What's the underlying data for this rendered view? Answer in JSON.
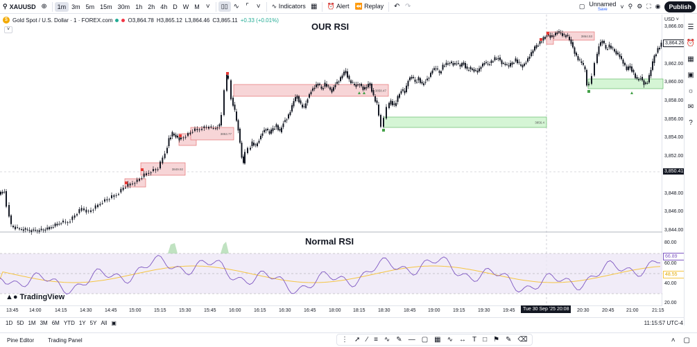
{
  "toolbar": {
    "symbol": "XAUUSD",
    "intervals": [
      "1m",
      "3m",
      "5m",
      "15m",
      "30m",
      "1h",
      "2h",
      "4h",
      "D",
      "W",
      "M"
    ],
    "active_interval": "1m",
    "indicators_label": "Indicators",
    "alert_label": "Alert",
    "replay_label": "Replay",
    "layout_name": "Unnamed",
    "layout_save": "Save",
    "publish_label": "Publish"
  },
  "legend": {
    "title": "Gold Spot / U.S. Dollar · 1 · FOREX.com",
    "open": "O3,864.78",
    "high": "H3,865.12",
    "low": "L3,864.46",
    "close": "C3,865.11",
    "change": "+0.33 (+0.01%)"
  },
  "panes": {
    "main_title": "OUR RSI",
    "rsi_title": "Normal RSI"
  },
  "currency": "USD",
  "price_scale": [
    "3,866.00",
    "3,864.26",
    "3,862.00",
    "3,860.00",
    "3,858.00",
    "3,856.00",
    "3,854.00",
    "3,852.00",
    "3,850.41",
    "3,848.00",
    "3,846.00",
    "3,844.00"
  ],
  "current_price": "3,864.26",
  "crosshair_price": "3,850.41",
  "rsi_scale": [
    "80.00",
    "66.89",
    "60.00",
    "48.55",
    "40.00",
    "20.00"
  ],
  "rsi_value": "66.89",
  "rsi_ma_value": "48.55",
  "zones": [
    {
      "label": "3849.92",
      "type": "red"
    },
    {
      "label": "3853.77",
      "type": "red"
    },
    {
      "label": "3858.47",
      "type": "red"
    },
    {
      "label": "3856.4",
      "type": "green"
    },
    {
      "label": "3864.53",
      "type": "red"
    }
  ],
  "time_labels": [
    "13:45",
    "14:00",
    "14:15",
    "14:30",
    "14:45",
    "15:00",
    "15:15",
    "15:30",
    "15:45",
    "16:00",
    "16:15",
    "16:30",
    "16:45",
    "18:00",
    "18:15",
    "18:30",
    "18:45",
    "19:00",
    "19:15",
    "19:30",
    "19:45",
    "20:30",
    "20:45",
    "21:00",
    "21:15"
  ],
  "crosshair_time": "Tue 30 Sep '25   20:08",
  "ranges": [
    "1D",
    "5D",
    "1M",
    "3M",
    "6M",
    "YTD",
    "1Y",
    "5Y",
    "All"
  ],
  "clock": "11:15:57 UTC-4",
  "bottom_tabs": [
    "Pine Editor",
    "Trading Panel"
  ],
  "brand": "TradingView",
  "colors": {
    "up": "#131722",
    "red_zone": "#f7d5d7",
    "green_zone": "#d5f5d5",
    "rsi_line": "#7e57c2",
    "rsi_ma": "#f5c542",
    "rsi_band": "#ede7f6"
  }
}
